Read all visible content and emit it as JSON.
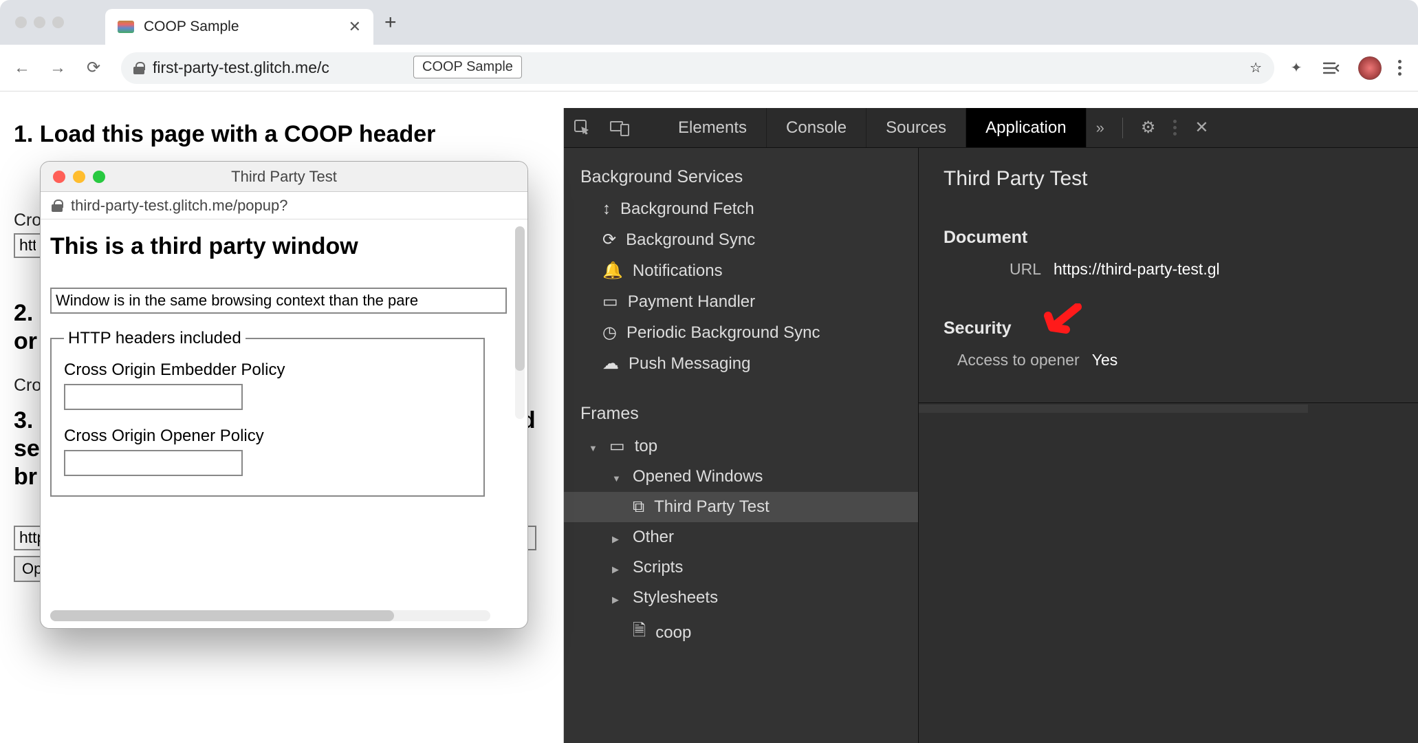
{
  "browser": {
    "tab_title": "COOP Sample",
    "url_display": "first-party-test.glitch.me/c",
    "url_tooltip": "COOP Sample"
  },
  "page": {
    "h1": "1. Load this page with a COOP header",
    "partial_cro_label": "Cro",
    "input_http_prefix": "http",
    "h2_text": "2.",
    "h2_or": "or",
    "h3_text": "3.",
    "h3_line2a": "se",
    "h3_line2b": "br",
    "h3_suffix": "d",
    "popup_url_value": "https://third-party-test.glitch.me/popup?",
    "open_btn": "Open a popup"
  },
  "popup": {
    "title": "Third Party Test",
    "url": "third-party-test.glitch.me/popup?",
    "heading": "This is a third party window",
    "status_msg": "Window is in the same browsing context than the pare",
    "legend": "HTTP headers included",
    "coep_label": "Cross Origin Embedder Policy",
    "coop_label": "Cross Origin Opener Policy"
  },
  "devtools": {
    "tabs": {
      "elements": "Elements",
      "console": "Console",
      "sources": "Sources",
      "application": "Application"
    },
    "side": {
      "bg_services": "Background Services",
      "items": {
        "bg_fetch": "Background Fetch",
        "bg_sync": "Background Sync",
        "notifications": "Notifications",
        "pay_handler": "Payment Handler",
        "periodic_sync": "Periodic Background Sync",
        "push_msg": "Push Messaging"
      },
      "frames": "Frames",
      "top": "top",
      "opened_windows": "Opened Windows",
      "third_party_test": "Third Party Test",
      "other": "Other",
      "scripts": "Scripts",
      "stylesheets": "Stylesheets",
      "coop": "coop"
    },
    "main": {
      "title": "Third Party Test",
      "document_h": "Document",
      "url_label": "URL",
      "url_value": "https://third-party-test.gl",
      "security_h": "Security",
      "access_opener_label": "Access to opener",
      "access_opener_value": "Yes"
    }
  }
}
